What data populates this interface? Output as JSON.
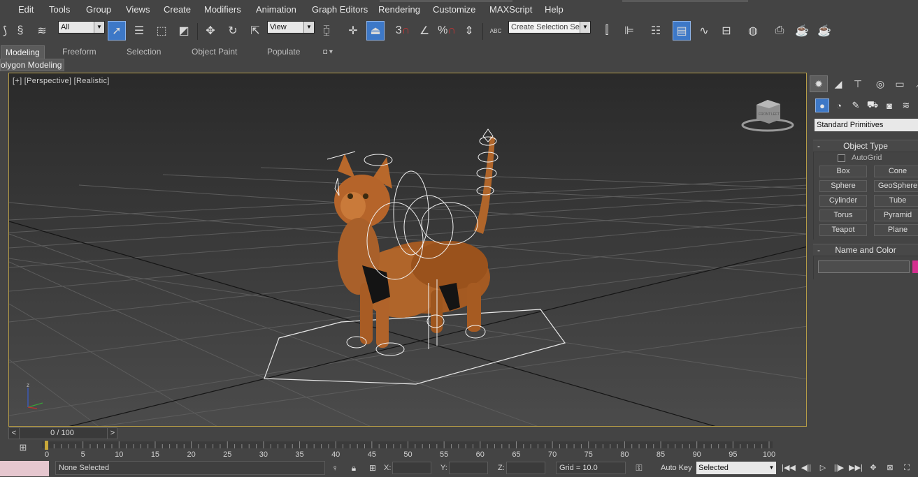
{
  "menubar": {
    "items": [
      "Edit",
      "Tools",
      "Group",
      "Views",
      "Create",
      "Modifiers",
      "Animation",
      "Graph Editors",
      "Rendering",
      "Customize",
      "MAXScript",
      "Help"
    ]
  },
  "toolbar": {
    "filter_value": "All",
    "ref_coord_value": "View",
    "selection_set_placeholder": "Create Selection Se",
    "snap_3_label": "3",
    "percent_snap_label": "%",
    "abc_label": "ABC"
  },
  "ribbon": {
    "tabs": [
      "Modeling",
      "Freeform",
      "Selection",
      "Object Paint",
      "Populate"
    ],
    "subtab": "olygon Modeling"
  },
  "viewport": {
    "label": "[+] [Perspective] [Realistic]",
    "viewcube_top": "FRONT",
    "viewcube_side": "LEFT",
    "axis_z": "z"
  },
  "command_panel": {
    "dropdown_value": "Standard Primitives",
    "object_type_title": "Object Type",
    "autogrid_label": "AutoGrid",
    "primitives": [
      "Box",
      "Cone",
      "Sphere",
      "GeoSphere",
      "Cylinder",
      "Tube",
      "Torus",
      "Pyramid",
      "Teapot",
      "Plane"
    ],
    "name_color_title": "Name and Color",
    "object_color": "#d42f8f"
  },
  "timeline": {
    "slider_value": "0 / 100",
    "prev_label": "<",
    "next_label": ">",
    "ticks": [
      "0",
      "5",
      "10",
      "15",
      "20",
      "25",
      "30",
      "35",
      "40",
      "45",
      "50",
      "55",
      "60",
      "65",
      "70",
      "75",
      "80",
      "85",
      "90",
      "95",
      "100"
    ]
  },
  "statusbar": {
    "selection_text": "None Selected",
    "x_label": "X:",
    "y_label": "Y:",
    "z_label": "Z:",
    "grid_text": "Grid = 10.0",
    "autokey_label": "Auto Key",
    "selected_value": "Selected"
  },
  "colors": {
    "viewport_border": "#b59c47",
    "active_blue": "#3d78c7",
    "status_pink": "#e6c7cf"
  }
}
